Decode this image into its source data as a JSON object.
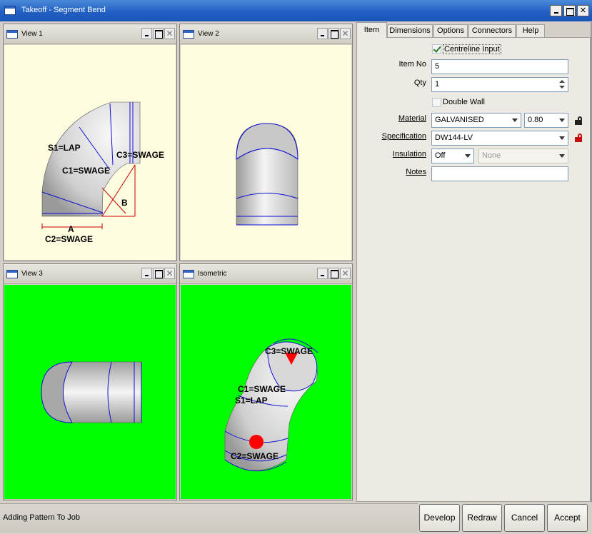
{
  "window": {
    "title": "Takeoff - Segment Bend",
    "controls": [
      "minimize",
      "maximize",
      "close"
    ]
  },
  "views": {
    "view1": {
      "title": "View 1",
      "background": "#fffde0",
      "labels": {
        "s1": "S1=LAP",
        "c1": "C1=SWAGE",
        "c3": "C3=SWAGE",
        "b": "B",
        "a": "A",
        "c2": "C2=SWAGE"
      }
    },
    "view2": {
      "title": "View 2",
      "background": "#fffde0"
    },
    "view3": {
      "title": "View 3",
      "background": "#00ff00"
    },
    "isometric": {
      "title": "Isometric",
      "background": "#00ff00",
      "labels": {
        "c3": "C3=SWAGE",
        "c1": "C1=SWAGE",
        "s1": "S1=LAP",
        "c2": "C2=SWAGE"
      }
    }
  },
  "tabs": [
    "Item",
    "Dimensions",
    "Options",
    "Connectors",
    "Help"
  ],
  "active_tab": "Item",
  "form": {
    "centreline_input": {
      "label": "Centreline Input",
      "checked": true
    },
    "item_no": {
      "label": "Item No",
      "value": "5"
    },
    "qty": {
      "label": "Qty",
      "value": "1"
    },
    "double_wall": {
      "label": "Double Wall",
      "checked": false
    },
    "material": {
      "label": "Material",
      "value": "GALVANISED",
      "gauge": "0.80"
    },
    "specification": {
      "label": "Specification",
      "value": "DW144-LV"
    },
    "insulation": {
      "label": "Insulation",
      "value": "Off",
      "type": "None"
    },
    "notes": {
      "label": "Notes",
      "value": ""
    }
  },
  "status": "Adding Pattern To Job",
  "buttons": {
    "develop": "Develop",
    "redraw": "Redraw",
    "cancel": "Cancel",
    "accept": "Accept"
  },
  "colors": {
    "seam_blue": "#1010d0",
    "dimension_red": "#cc0000",
    "marker_red": "#ff0000"
  }
}
